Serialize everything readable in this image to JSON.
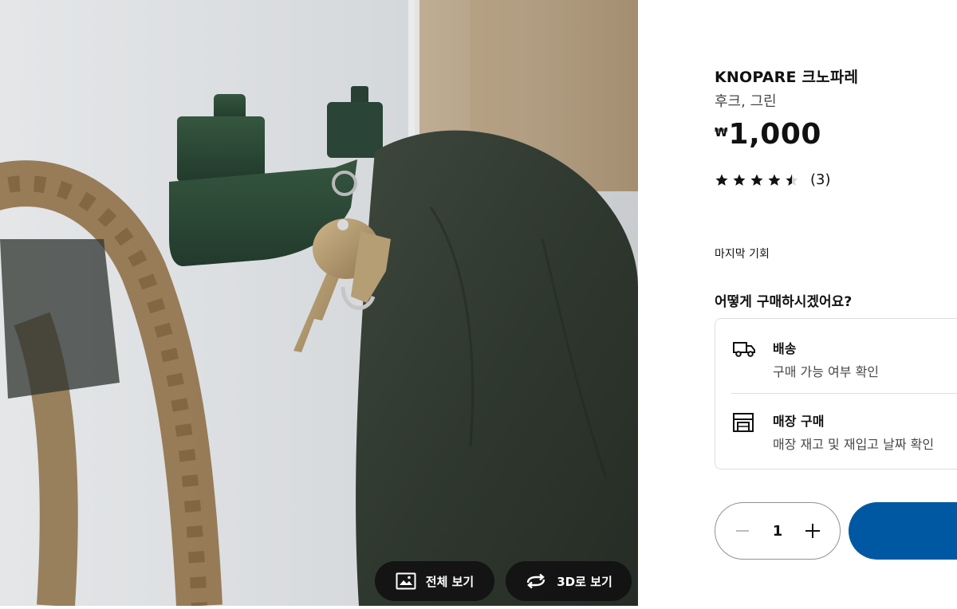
{
  "product": {
    "name": "KNOPARE 크노파레",
    "description": "후크, 그린",
    "currency_symbol": "₩",
    "price": "1,000",
    "rating": 4.5,
    "rating_count": "(3)",
    "availability_note": "마지막 기회"
  },
  "purchase": {
    "heading": "어떻게 구매하시겠어요?",
    "delivery": {
      "title": "배송",
      "subtitle": "구매 가능 여부 확인",
      "icon": "truck-icon"
    },
    "store": {
      "title": "매장 구매",
      "subtitle": "매장 재고 및 재입고 날짜 확인",
      "icon": "store-icon"
    },
    "quantity": "1"
  },
  "gallery": {
    "fullscreen_label": "전체 보기",
    "view3d_label": "3D로 보기"
  },
  "colors": {
    "primary_blue": "#0058a3",
    "hook_green": "#2b4538",
    "text_dark": "#111111",
    "text_muted": "#484848"
  }
}
